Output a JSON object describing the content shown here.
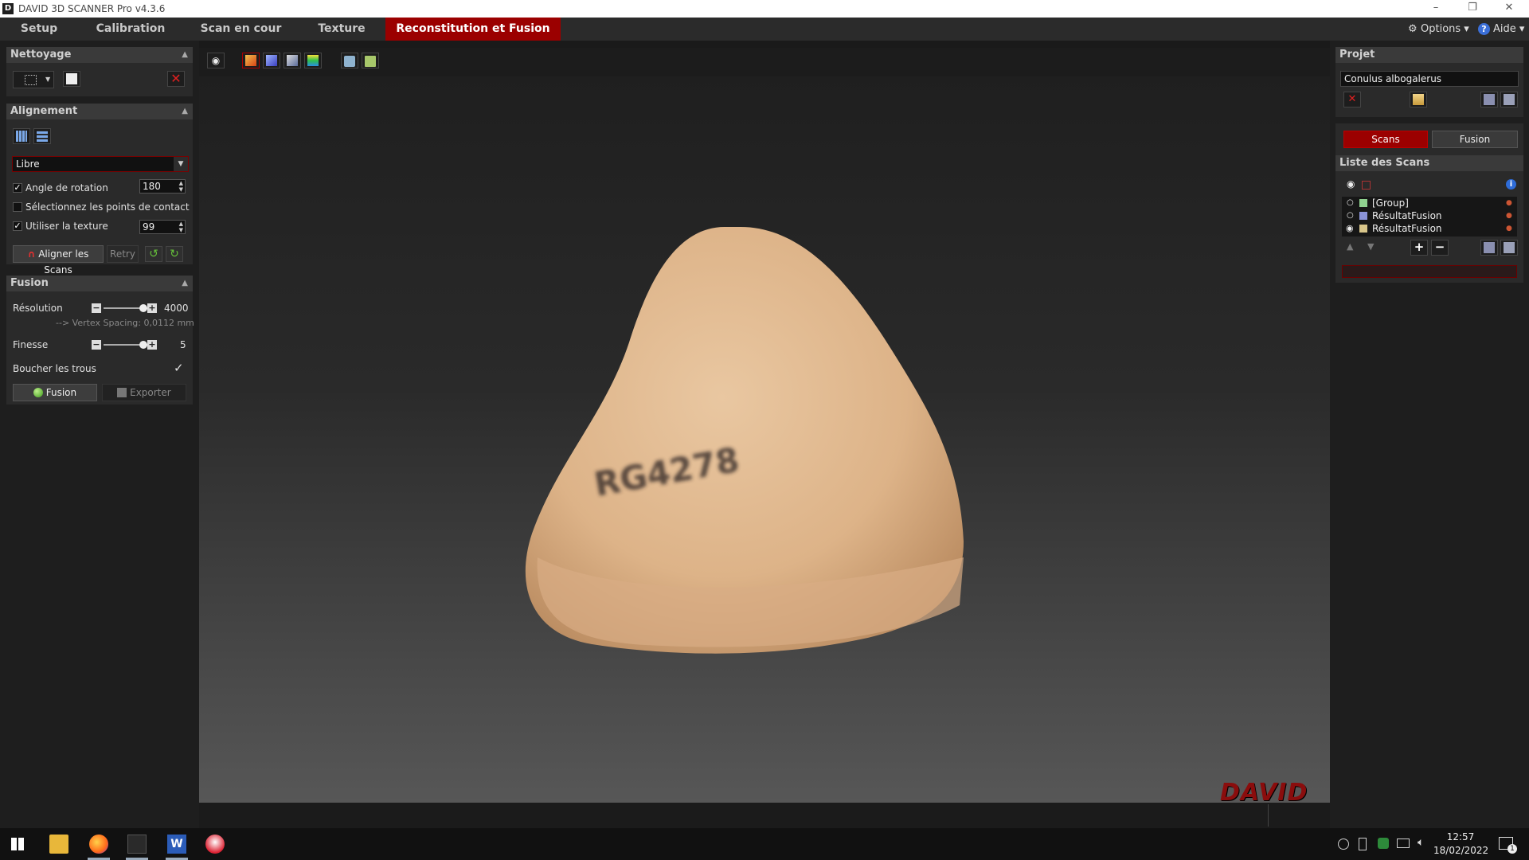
{
  "window": {
    "title": "DAVID 3D SCANNER Pro v4.3.6",
    "controls": {
      "minimize": "–",
      "restore": "❐",
      "close": "✕"
    }
  },
  "menu": {
    "tabs": [
      "Setup",
      "Calibration",
      "Scan en cour",
      "Texture",
      "Reconstitution et Fusion"
    ],
    "active_tab": "Reconstitution et Fusion",
    "options": "Options ▾",
    "help": "Aide ▾"
  },
  "nettoyage": {
    "title": "Nettoyage"
  },
  "alignement": {
    "title": "Alignement",
    "mode": "Libre",
    "rotation_label": "Angle de rotation",
    "rotation_value": "180",
    "rotation_checked": true,
    "contact_label": "Sélectionnez les points de contact",
    "contact_checked": false,
    "texture_label": "Utiliser la texture",
    "texture_value": "99",
    "texture_checked": true,
    "align_button": "Aligner les Scans",
    "retry_button": "Retry"
  },
  "fusion": {
    "title": "Fusion",
    "resolution_label": "Résolution",
    "resolution_value": "4000",
    "vertex_spacing": "--> Vertex Spacing: 0,0112 mm",
    "finesse_label": "Finesse",
    "finesse_value": "5",
    "holes_label": "Boucher les trous",
    "holes_checked": true,
    "fusion_button": "Fusion",
    "export_button": "Exporter"
  },
  "viewport": {
    "object_label": "RG4278",
    "brand": "DAVID"
  },
  "projet": {
    "title": "Projet",
    "name": "Conulus albogalerus",
    "tab_scans": "Scans",
    "tab_fusion": "Fusion"
  },
  "scan_list": {
    "title": "Liste des Scans",
    "items": [
      {
        "name": "[Group]",
        "color": "#8fd18f",
        "visible": false
      },
      {
        "name": "RésultatFusion",
        "color": "#8a93d8",
        "visible": false
      },
      {
        "name": "RésultatFusion",
        "color": "#d8c58a",
        "visible": true
      }
    ]
  },
  "taskbar": {
    "time": "12:57",
    "date": "18/02/2022",
    "notifications": "1"
  },
  "colors": {
    "accent": "#9b0000",
    "panel": "#2a2a2a",
    "header": "#3a3a3a"
  }
}
